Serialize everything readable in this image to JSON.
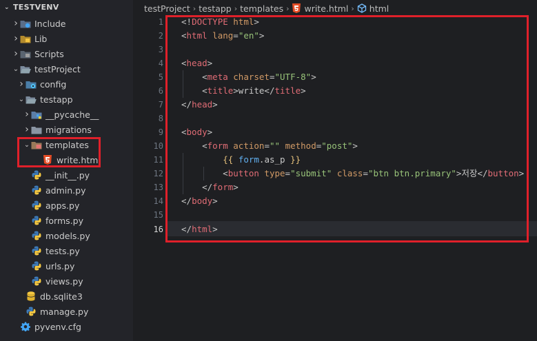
{
  "explorer": {
    "root": "TESTVENV",
    "items": [
      {
        "label": "Include",
        "depth": 0,
        "type": "folder",
        "chevron": "right",
        "icon": "folder-include-icon"
      },
      {
        "label": "Lib",
        "depth": 0,
        "type": "folder",
        "chevron": "right",
        "icon": "folder-lib-icon"
      },
      {
        "label": "Scripts",
        "depth": 0,
        "type": "folder",
        "chevron": "right",
        "icon": "folder-scripts-icon"
      },
      {
        "label": "testProject",
        "depth": 0,
        "type": "folder",
        "chevron": "down",
        "icon": "folder-open-icon"
      },
      {
        "label": "config",
        "depth": 1,
        "type": "folder",
        "chevron": "right",
        "icon": "folder-config-icon"
      },
      {
        "label": "testapp",
        "depth": 1,
        "type": "folder",
        "chevron": "down",
        "icon": "folder-open-icon"
      },
      {
        "label": "__pycache__",
        "depth": 2,
        "type": "folder",
        "chevron": "right",
        "icon": "folder-python-icon"
      },
      {
        "label": "migrations",
        "depth": 2,
        "type": "folder",
        "chevron": "right",
        "icon": "folder-icon"
      },
      {
        "label": "templates",
        "depth": 2,
        "type": "folder",
        "chevron": "down",
        "icon": "folder-templates-icon"
      },
      {
        "label": "write.html",
        "depth": 3,
        "type": "file",
        "icon": "html5-icon"
      },
      {
        "label": "__init__.py",
        "depth": 2,
        "type": "file",
        "icon": "python-icon"
      },
      {
        "label": "admin.py",
        "depth": 2,
        "type": "file",
        "icon": "python-icon"
      },
      {
        "label": "apps.py",
        "depth": 2,
        "type": "file",
        "icon": "python-icon"
      },
      {
        "label": "forms.py",
        "depth": 2,
        "type": "file",
        "icon": "python-icon"
      },
      {
        "label": "models.py",
        "depth": 2,
        "type": "file",
        "icon": "python-icon"
      },
      {
        "label": "tests.py",
        "depth": 2,
        "type": "file",
        "icon": "python-icon"
      },
      {
        "label": "urls.py",
        "depth": 2,
        "type": "file",
        "icon": "python-icon"
      },
      {
        "label": "views.py",
        "depth": 2,
        "type": "file",
        "icon": "python-icon"
      },
      {
        "label": "db.sqlite3",
        "depth": 1,
        "type": "file",
        "icon": "database-icon"
      },
      {
        "label": "manage.py",
        "depth": 1,
        "type": "file",
        "icon": "python-icon"
      },
      {
        "label": "pyvenv.cfg",
        "depth": 0,
        "type": "file",
        "icon": "gear-icon"
      }
    ]
  },
  "breadcrumb": [
    "testProject",
    "testapp",
    "templates",
    "write.html",
    "html"
  ],
  "editor": {
    "active_line": 16,
    "lines": [
      [
        {
          "c": "p",
          "t": "<!"
        },
        {
          "c": "t",
          "t": "DOCTYPE"
        },
        {
          "c": "p",
          "t": " "
        },
        {
          "c": "a",
          "t": "html"
        },
        {
          "c": "p",
          "t": ">"
        }
      ],
      [
        {
          "c": "p",
          "t": "<"
        },
        {
          "c": "t",
          "t": "html"
        },
        {
          "c": "p",
          "t": " "
        },
        {
          "c": "a",
          "t": "lang"
        },
        {
          "c": "p",
          "t": "="
        },
        {
          "c": "s",
          "t": "\"en\""
        },
        {
          "c": "p",
          "t": ">"
        }
      ],
      [],
      [
        {
          "c": "p",
          "t": "<"
        },
        {
          "c": "t",
          "t": "head"
        },
        {
          "c": "p",
          "t": ">"
        }
      ],
      [
        {
          "c": "p",
          "t": "    <"
        },
        {
          "c": "t",
          "t": "meta"
        },
        {
          "c": "p",
          "t": " "
        },
        {
          "c": "a",
          "t": "charset"
        },
        {
          "c": "p",
          "t": "="
        },
        {
          "c": "s",
          "t": "\"UTF-8\""
        },
        {
          "c": "p",
          "t": ">"
        }
      ],
      [
        {
          "c": "p",
          "t": "    <"
        },
        {
          "c": "t",
          "t": "title"
        },
        {
          "c": "p",
          "t": ">write</"
        },
        {
          "c": "t",
          "t": "title"
        },
        {
          "c": "p",
          "t": ">"
        }
      ],
      [
        {
          "c": "p",
          "t": "</"
        },
        {
          "c": "t",
          "t": "head"
        },
        {
          "c": "p",
          "t": ">"
        }
      ],
      [],
      [
        {
          "c": "p",
          "t": "<"
        },
        {
          "c": "t",
          "t": "body"
        },
        {
          "c": "p",
          "t": ">"
        }
      ],
      [
        {
          "c": "p",
          "t": "    <"
        },
        {
          "c": "t",
          "t": "form"
        },
        {
          "c": "p",
          "t": " "
        },
        {
          "c": "a",
          "t": "action"
        },
        {
          "c": "p",
          "t": "="
        },
        {
          "c": "s",
          "t": "\"\""
        },
        {
          "c": "p",
          "t": " "
        },
        {
          "c": "a",
          "t": "method"
        },
        {
          "c": "p",
          "t": "="
        },
        {
          "c": "s",
          "t": "\"post\""
        },
        {
          "c": "p",
          "t": ">"
        }
      ],
      [
        {
          "c": "p",
          "t": "        "
        },
        {
          "c": "b",
          "t": "{{"
        },
        {
          "c": "p",
          "t": " "
        },
        {
          "c": "v",
          "t": "form"
        },
        {
          "c": "p",
          "t": ".as_p "
        },
        {
          "c": "b",
          "t": "}}"
        }
      ],
      [
        {
          "c": "p",
          "t": "        <"
        },
        {
          "c": "t",
          "t": "button"
        },
        {
          "c": "p",
          "t": " "
        },
        {
          "c": "a",
          "t": "type"
        },
        {
          "c": "p",
          "t": "="
        },
        {
          "c": "s",
          "t": "\"submit\""
        },
        {
          "c": "p",
          "t": " "
        },
        {
          "c": "a",
          "t": "class"
        },
        {
          "c": "p",
          "t": "="
        },
        {
          "c": "s",
          "t": "\"btn btn.primary\""
        },
        {
          "c": "p",
          "t": ">저장</"
        },
        {
          "c": "t",
          "t": "button"
        },
        {
          "c": "p",
          "t": ">"
        }
      ],
      [
        {
          "c": "p",
          "t": "    </"
        },
        {
          "c": "t",
          "t": "form"
        },
        {
          "c": "p",
          "t": ">"
        }
      ],
      [
        {
          "c": "p",
          "t": "</"
        },
        {
          "c": "t",
          "t": "body"
        },
        {
          "c": "p",
          "t": ">"
        }
      ],
      [],
      [
        {
          "c": "p",
          "t": "</"
        },
        {
          "c": "t",
          "t": "html"
        },
        {
          "c": "p",
          "t": ">"
        }
      ]
    ]
  },
  "colors": {
    "highlight_box": "#e0202a",
    "tag": "#e06c75",
    "attr": "#d19a66",
    "string": "#98c379"
  }
}
